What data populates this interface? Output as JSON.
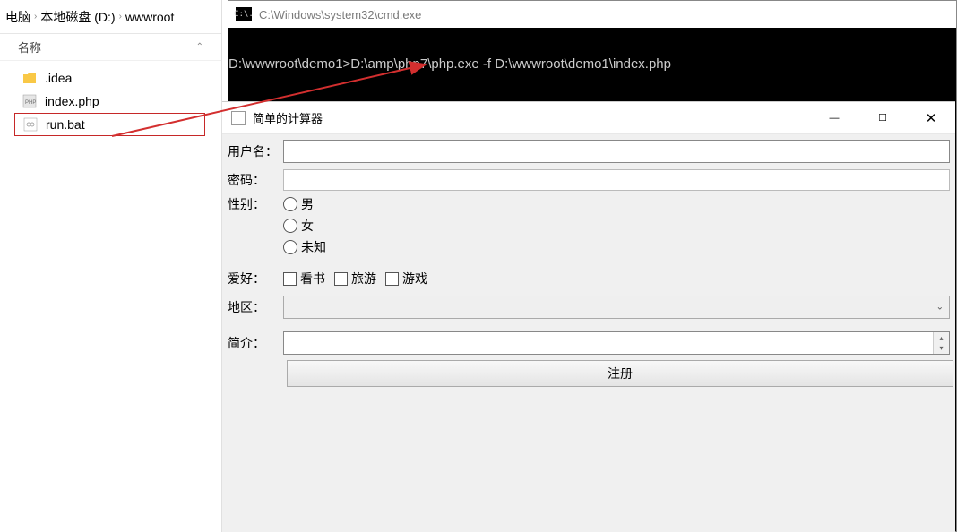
{
  "explorer": {
    "breadcrumb": {
      "part1": "电脑",
      "part2": "本地磁盘 (D:)",
      "part3": "wwwroot"
    },
    "column_header": "名称",
    "files": [
      {
        "name": ".idea",
        "type": "folder"
      },
      {
        "name": "index.php",
        "type": "php"
      },
      {
        "name": "run.bat",
        "type": "bat",
        "selected": true
      }
    ]
  },
  "cmd": {
    "title": "C:\\Windows\\system32\\cmd.exe",
    "icon_text": "C:\\.",
    "command_line": "D:\\wwwroot\\demo1>D:\\amp\\php7\\php.exe -f D:\\wwwroot\\demo1\\index.php"
  },
  "form": {
    "title": "简单的计算器",
    "labels": {
      "username": "用户名：",
      "password": "密码：",
      "gender": "性别：",
      "hobby": "爱好：",
      "region": "地区：",
      "intro": "简介："
    },
    "gender_options": [
      "男",
      "女",
      "未知"
    ],
    "hobby_options": [
      "看书",
      "旅游",
      "游戏"
    ],
    "submit": "注册",
    "window_controls": {
      "min": "—",
      "max": "☐",
      "close": "✕"
    }
  }
}
